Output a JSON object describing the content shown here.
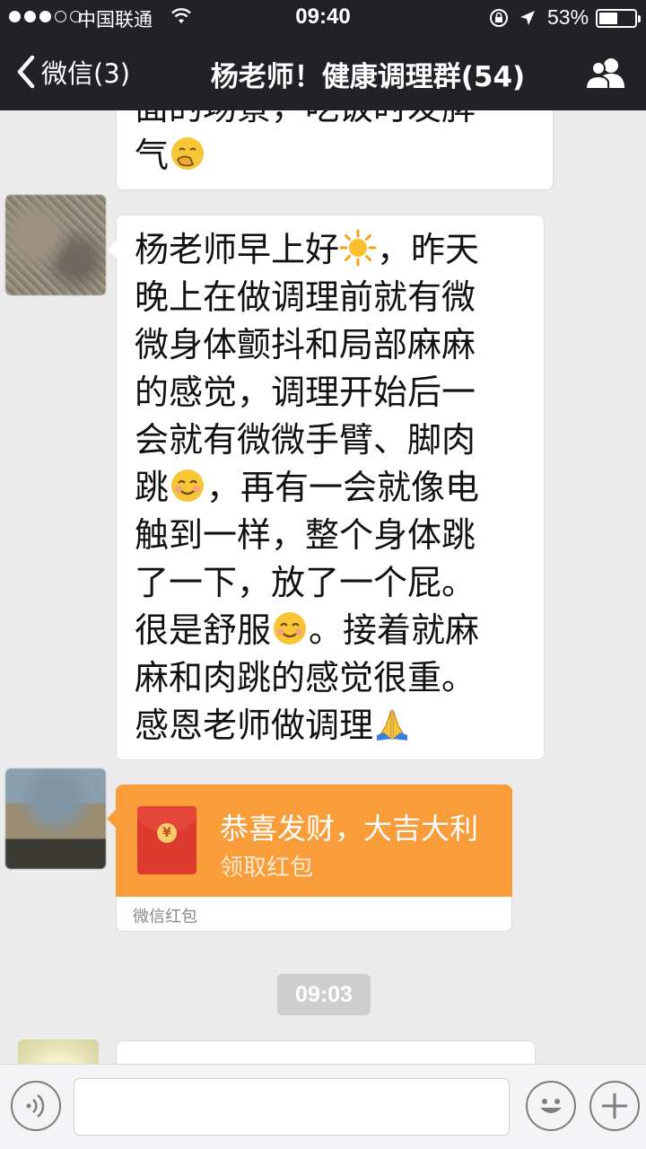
{
  "status_bar": {
    "carrier": "中国联通",
    "time": "09:40",
    "battery": "53%",
    "battery_level": 0.53,
    "signal_bars_filled": 3,
    "signal_bars_total": 5
  },
  "nav": {
    "back_label": "微信(3)",
    "title": "杨老师！健康调理群(54)"
  },
  "messages": {
    "prev_line1": "面的场景，吃饭时发脾",
    "prev_line2": "气",
    "main": {
      "lines": [
        "杨老师早上好",
        "，昨天",
        "晚上在做调理前就有微",
        "微身体颤抖和局部麻麻",
        "的感觉，调理开始后一",
        "会就有微微手臂、脚肉",
        "跳",
        "，再有一会就像电",
        "触到一样，整个身体跳",
        "了一下，放了一个屁。",
        "很是舒服",
        "。接着就麻",
        "麻和肉跳的感觉很重。",
        "感恩老师做调理"
      ]
    },
    "red_packet": {
      "title": "恭喜发财，大吉大利",
      "action": "领取红包",
      "footer": "微信红包",
      "symbol": "¥"
    },
    "timestamp": "09:03"
  },
  "input": {
    "value": ""
  },
  "colors": {
    "bar_bg": "#222226",
    "chat_bg": "#ebebeb",
    "red_packet_orange": "#f99d3a",
    "red_packet_red": "#dc3a2f"
  }
}
